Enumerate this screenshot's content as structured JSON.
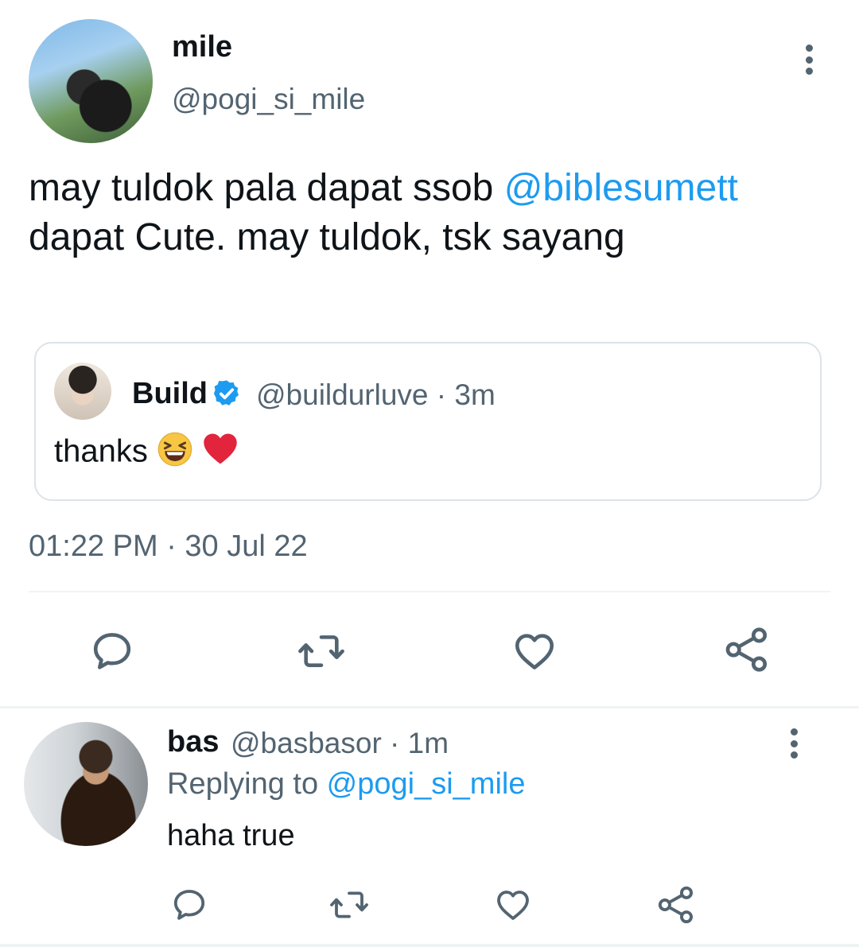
{
  "tweet": {
    "author_name": "mile",
    "author_handle": "@pogi_si_mile",
    "text_before": "may tuldok pala dapat ssob ",
    "mention": "@biblesumett",
    "text_after": " dapat Cute. may tuldok, tsk sayang",
    "timestamp": "01:22 PM · 30 Jul 22"
  },
  "quoted_tweet": {
    "author_name": "Build",
    "author_handle": "@buildurluve · 3m",
    "text": "thanks",
    "verified": true
  },
  "actions": {
    "reply_icon": "reply-icon",
    "retweet_icon": "retweet-icon",
    "like_icon": "heart-icon",
    "share_icon": "share-icon"
  },
  "reply": {
    "author_name": "bas",
    "meta": "@basbasor · 1m",
    "replying_label": "Replying to ",
    "replying_handle": "@pogi_si_mile",
    "text": "haha true"
  },
  "colors": {
    "link": "#1d9bf0",
    "secondary": "#536471",
    "divider": "#eff3f4"
  }
}
